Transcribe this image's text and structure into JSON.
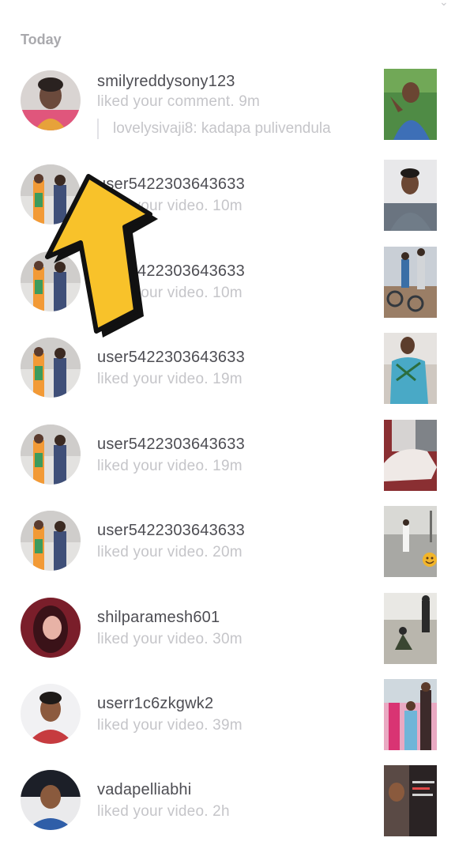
{
  "section_header": "Today",
  "notifications": [
    {
      "username": "smilyreddysony123",
      "activity": "liked your comment. 9m",
      "reply": "lovelysivaji8: kadapa pulivendula"
    },
    {
      "username": "user5422303643633",
      "activity": "liked your video. 10m"
    },
    {
      "username": "user5422303643633",
      "activity": "liked your video. 10m"
    },
    {
      "username": "user5422303643633",
      "activity": "liked your video. 19m"
    },
    {
      "username": "user5422303643633",
      "activity": "liked your video. 19m"
    },
    {
      "username": "user5422303643633",
      "activity": "liked your video. 20m"
    },
    {
      "username": "shilparamesh601",
      "activity": "liked your video. 30m"
    },
    {
      "username": "userr1c6zkgwk2",
      "activity": "liked your video. 39m"
    },
    {
      "username": "vadapelliabhi",
      "activity": "liked your video. 2h"
    }
  ],
  "colors": {
    "arrow_fill": "#f8c22a",
    "arrow_outline": "#111111",
    "secondary_text": "#c5c5c9",
    "primary_text": "#4d4d53"
  }
}
